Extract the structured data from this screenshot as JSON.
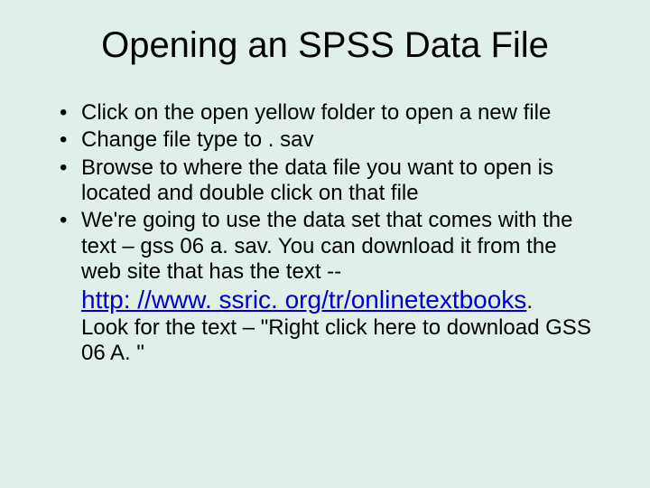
{
  "title": "Opening an SPSS Data File",
  "bullets": {
    "b1": "Click on the open yellow folder to open a new file",
    "b2": "Change file type to . sav",
    "b3": "Browse to where the data file you want to open is located and double click on that file",
    "b4_pre": "We're going to use the data set that comes with the text – gss 06 a. sav.  You can download it from the web site that has the text -- ",
    "b4_link": "http: //www. ssric. org/tr/onlinetextbooks",
    "b4_dot": ". ",
    "b4_post": "Look for the text – \"Right click here to download GSS 06 A. \""
  }
}
